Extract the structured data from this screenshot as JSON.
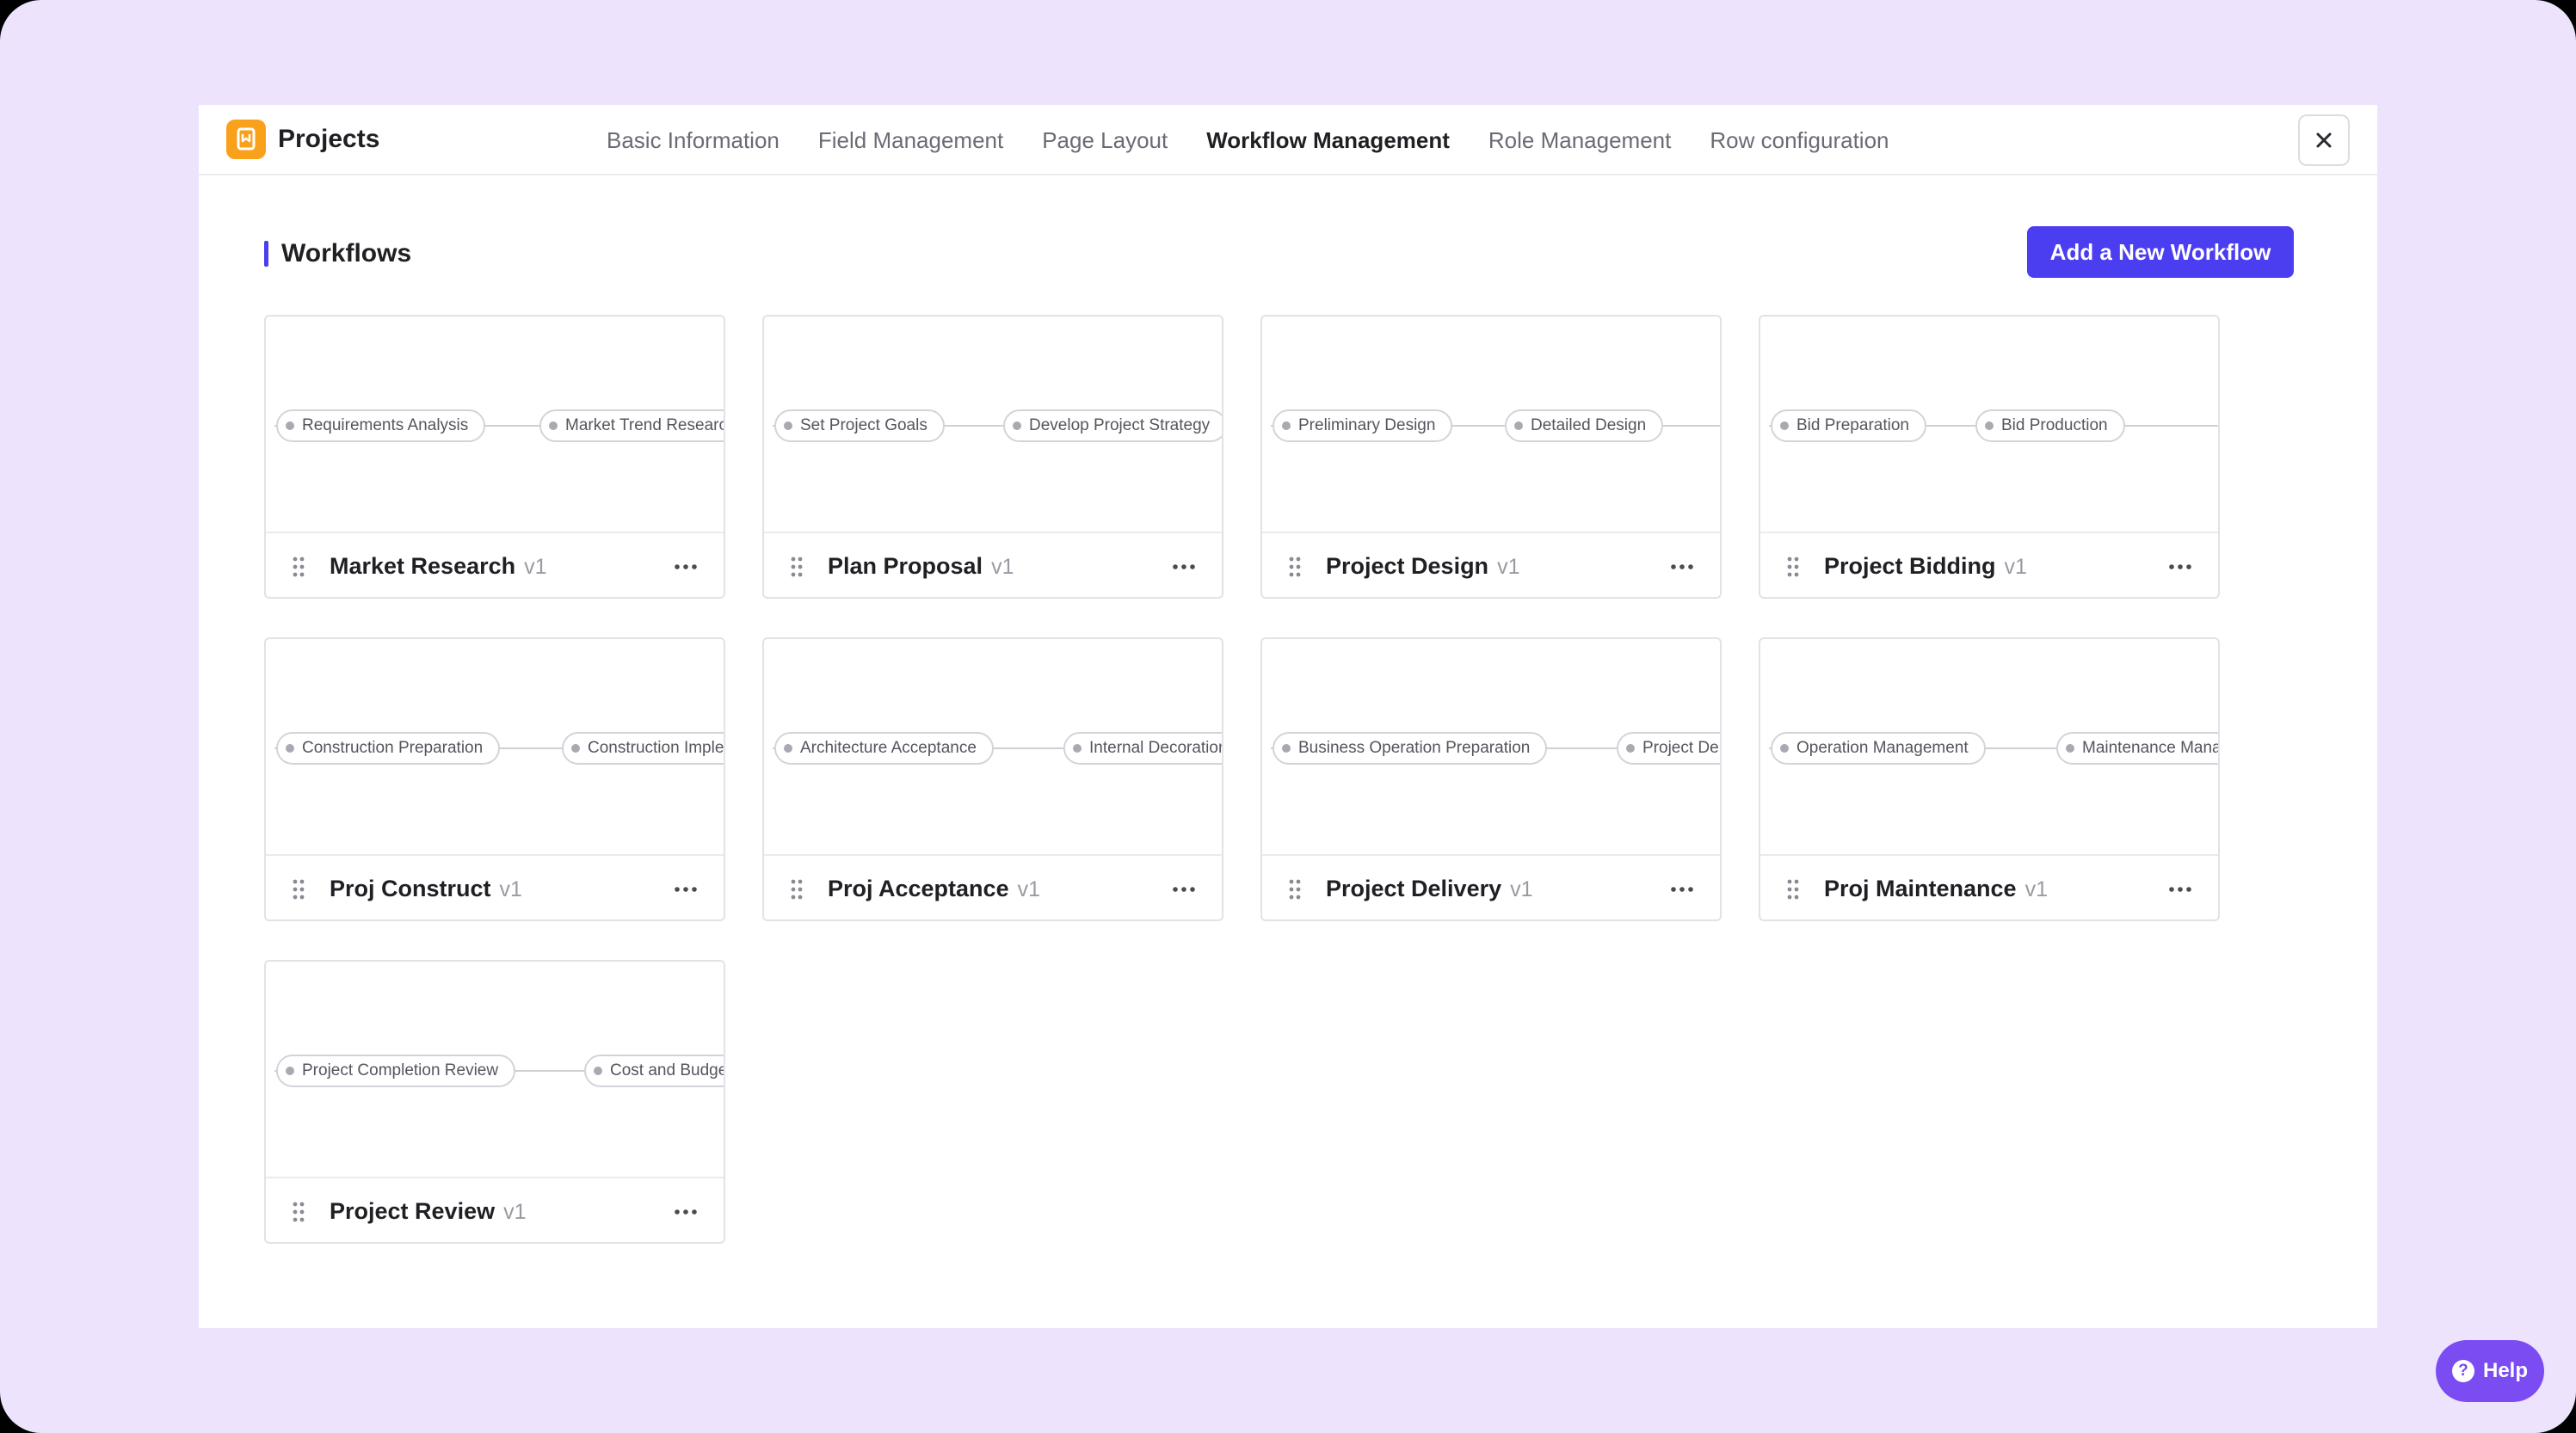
{
  "header": {
    "app_title": "Projects",
    "logo_icon": "bookmark-icon",
    "tabs": [
      {
        "label": "Basic Information",
        "active": false
      },
      {
        "label": "Field Management",
        "active": false
      },
      {
        "label": "Page Layout",
        "active": false
      },
      {
        "label": "Workflow Management",
        "active": true
      },
      {
        "label": "Role Management",
        "active": false
      },
      {
        "label": "Row configuration",
        "active": false
      }
    ],
    "close_icon": "close-icon"
  },
  "section": {
    "title": "Workflows",
    "add_button_label": "Add a New Workflow"
  },
  "workflows": [
    {
      "name": "Market Research",
      "version": "v1",
      "nodes": [
        "Requirements Analysis",
        "Market Trend Research"
      ]
    },
    {
      "name": "Plan Proposal",
      "version": "v1",
      "nodes": [
        "Set Project Goals",
        "Develop Project Strategy"
      ]
    },
    {
      "name": "Project Design",
      "version": "v1",
      "nodes": [
        "Preliminary Design",
        "Detailed Design"
      ]
    },
    {
      "name": "Project Bidding",
      "version": "v1",
      "nodes": [
        "Bid Preparation",
        "Bid Production"
      ]
    },
    {
      "name": "Proj Construct",
      "version": "v1",
      "nodes": [
        "Construction Preparation",
        "Construction Implementation"
      ]
    },
    {
      "name": "Proj Acceptance",
      "version": "v1",
      "nodes": [
        "Architecture Acceptance",
        "Internal Decoration"
      ]
    },
    {
      "name": "Project Delivery",
      "version": "v1",
      "nodes": [
        "Business Operation Preparation",
        "Project Delivery"
      ]
    },
    {
      "name": "Proj Maintenance",
      "version": "v1",
      "nodes": [
        "Operation Management",
        "Maintenance Management"
      ]
    },
    {
      "name": "Project Review",
      "version": "v1",
      "nodes": [
        "Project Completion Review",
        "Cost and Budget"
      ]
    }
  ],
  "help": {
    "label": "Help"
  },
  "colors": {
    "accent": "#4b3df0",
    "help": "#7b4cf2",
    "logo": "#f9a11b",
    "frame_background": "#ede3fc"
  }
}
